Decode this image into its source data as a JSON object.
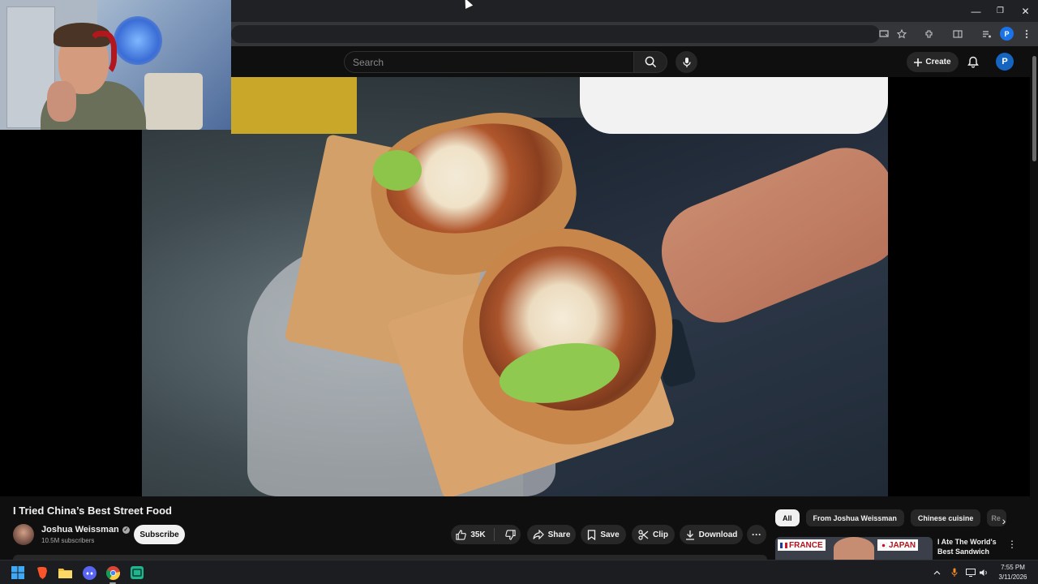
{
  "browser": {
    "window_controls": {
      "minimize": "—",
      "restore": "❐",
      "close": "✕"
    },
    "toolbar_icons": [
      "cast-icon",
      "star-icon",
      "extensions-icon",
      "side-panel-icon",
      "media-icon",
      "profile-avatar",
      "menu-icon"
    ],
    "profile_initial": "P"
  },
  "masthead": {
    "search_placeholder": "Search",
    "create_label": "Create",
    "avatar_initial": "P"
  },
  "video": {
    "title": "I Tried China’s Best Street Food",
    "channel": {
      "name": "Joshua Weissman",
      "subscribers": "10.5M subscribers",
      "verified_mark": "✓"
    },
    "actions": {
      "subscribe": "Subscribe",
      "likes": "35K",
      "share": "Share",
      "save": "Save",
      "clip": "Clip",
      "download": "Download",
      "more": "···"
    }
  },
  "recommendations": {
    "chips": [
      "All",
      "From Joshua Weissman",
      "Chinese cuisine",
      "Re"
    ],
    "active_chip": "All",
    "next_label": "›",
    "first_item": {
      "title": "I Ate The World's Best Sandwich",
      "thumb_labels": [
        "FRANCE",
        "JAPAN"
      ],
      "menu": "⋮"
    }
  },
  "taskbar": {
    "time": "7:55 PM",
    "date": "3/11/2026",
    "apps": [
      "windows-start",
      "brave",
      "file-explorer",
      "discord",
      "chrome",
      "terminal-app"
    ]
  },
  "colors": {
    "youtube_bg": "#0f0f0f",
    "pill_bg": "#272727",
    "avatar_blue": "#1565c0",
    "headset_red": "#b3161c"
  }
}
